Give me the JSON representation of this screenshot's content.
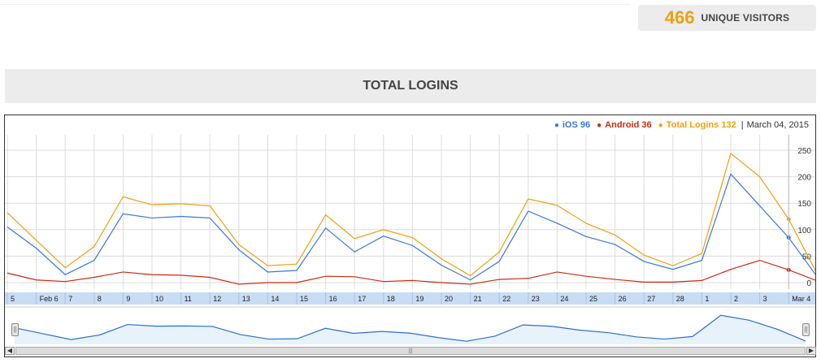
{
  "stats": {
    "value": "466",
    "label": "UNIQUE VISITORS"
  },
  "section": {
    "title": "TOTAL LOGINS"
  },
  "legend": {
    "items": [
      {
        "name": "iOS",
        "value": "96",
        "color": "#3b78d8"
      },
      {
        "name": "Android",
        "value": "36",
        "color": "#cc2a10"
      },
      {
        "name": "Total Logins",
        "value": "132",
        "color": "#f0a010"
      }
    ],
    "date": "March 04, 2015"
  },
  "colors": {
    "ios": "#3b78d8",
    "android": "#cc2a10",
    "total": "#f0a010",
    "navigator_line": "#2a6fd0",
    "navigator_fill": "#e8f2fb",
    "xaxis_band": "#c8dcf4"
  },
  "navigator": {
    "scroll_grip": "|||"
  },
  "chart_data": {
    "type": "line",
    "x": [
      "5",
      "Feb 6",
      "7",
      "8",
      "9",
      "10",
      "11",
      "12",
      "13",
      "14",
      "15",
      "16",
      "17",
      "18",
      "19",
      "20",
      "21",
      "22",
      "23",
      "24",
      "25",
      "26",
      "27",
      "28",
      "1",
      "2",
      "3",
      "Mar 4",
      "5"
    ],
    "series": [
      {
        "name": "iOS",
        "values": [
          105,
          65,
          15,
          42,
          130,
          122,
          125,
          122,
          62,
          20,
          23,
          103,
          58,
          88,
          70,
          33,
          5,
          40,
          135,
          112,
          87,
          72,
          40,
          25,
          42,
          205,
          145,
          85,
          10
        ]
      },
      {
        "name": "Android",
        "values": [
          18,
          5,
          2,
          10,
          20,
          15,
          14,
          10,
          -3,
          0,
          0,
          12,
          11,
          2,
          4,
          0,
          -3,
          6,
          8,
          20,
          12,
          6,
          1,
          1,
          4,
          25,
          42,
          24,
          3
        ]
      },
      {
        "name": "Total Logins",
        "values": [
          132,
          80,
          28,
          68,
          162,
          147,
          149,
          145,
          72,
          32,
          35,
          128,
          83,
          100,
          85,
          45,
          13,
          58,
          158,
          146,
          112,
          90,
          52,
          32,
          55,
          244,
          200,
          120,
          15
        ]
      }
    ],
    "y_ticks": [
      "250",
      "200",
      "150",
      "100",
      "50",
      "0"
    ],
    "ylim": [
      -10,
      280
    ],
    "grid": true,
    "legend_position": "top-right",
    "navigator_values": [
      132,
      80,
      28,
      68,
      162,
      147,
      149,
      145,
      72,
      32,
      35,
      128,
      83,
      100,
      85,
      45,
      13,
      58,
      158,
      146,
      112,
      90,
      52,
      32,
      55,
      244,
      200,
      120,
      15
    ]
  }
}
